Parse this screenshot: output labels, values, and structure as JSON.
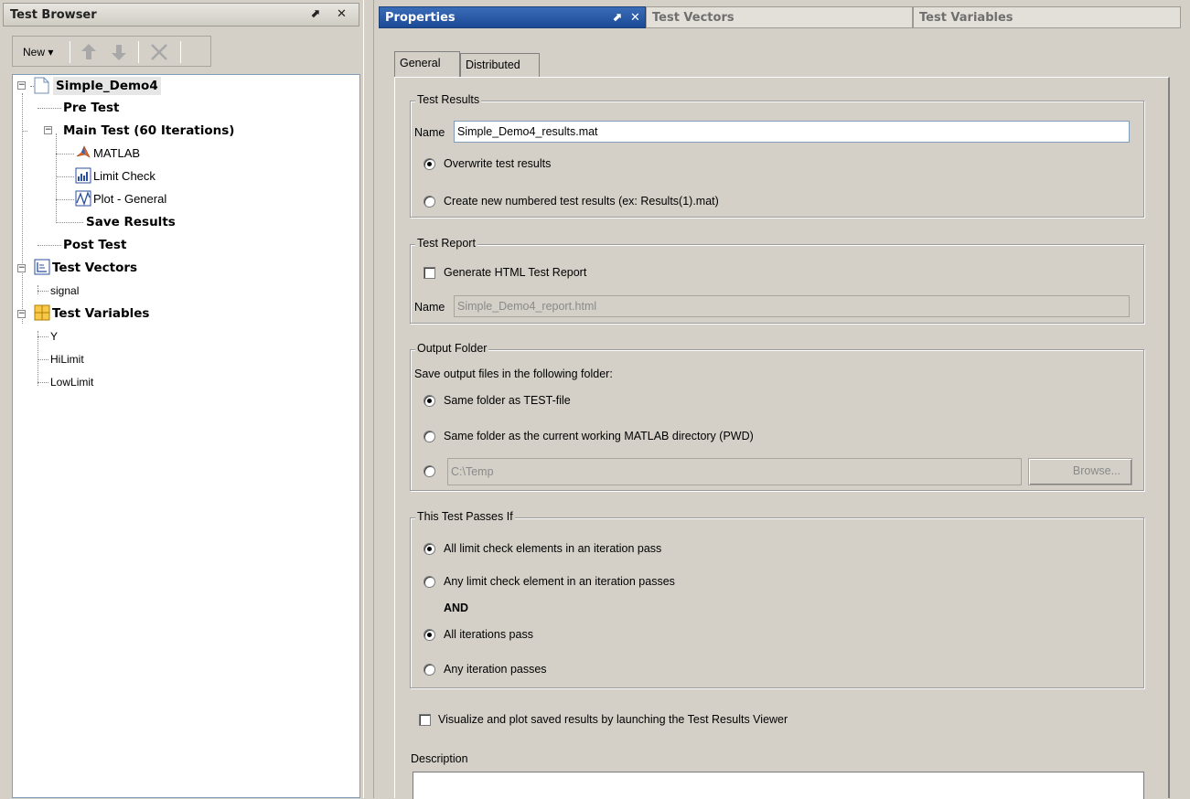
{
  "left_panel": {
    "title": "Test Browser",
    "undock": "⬈",
    "close": "✕",
    "toolbar": {
      "new_label": "New ▾"
    },
    "tree": {
      "root": "Simple_Demo4",
      "pre_test": "Pre Test",
      "main_test": "Main Test (60 Iterations)",
      "matlab": "MATLAB",
      "limit_check": "Limit Check",
      "plot_general": "Plot - General",
      "save_results": "Save Results",
      "post_test": "Post Test",
      "test_vectors": "Test Vectors",
      "signal": "signal",
      "test_variables": "Test Variables",
      "var_y": "Y",
      "var_hilimit": "HiLimit",
      "var_lowlimit": "LowLimit"
    }
  },
  "right_panel": {
    "tabs": [
      {
        "label": "Properties",
        "active": true
      },
      {
        "label": "Test Vectors",
        "active": false
      },
      {
        "label": "Test Variables",
        "active": false
      }
    ],
    "undock": "⬈",
    "close": "✕",
    "subtabs": {
      "general": "General",
      "distributed": "Distributed"
    },
    "test_results": {
      "legend": "Test Results",
      "name_label": "Name",
      "name_value": "Simple_Demo4_results.mat",
      "overwrite": "Overwrite test results",
      "create_new": "Create new numbered test results (ex: Results(1).mat)"
    },
    "test_report": {
      "legend": "Test Report",
      "generate": "Generate HTML Test Report",
      "name_label": "Name",
      "name_value": "Simple_Demo4_report.html"
    },
    "output_folder": {
      "legend": "Output Folder",
      "intro": "Save output files in the following folder:",
      "same_folder": "Same folder as TEST-file",
      "pwd_folder": "Same folder as the current working MATLAB directory (PWD)",
      "custom_path": "C:\\Temp",
      "browse": "Browse..."
    },
    "passes_if": {
      "legend": "This Test Passes If",
      "all_limit": "All limit check elements in an iteration pass",
      "any_limit": "Any limit check element in an iteration passes",
      "and_label": "AND",
      "all_iter": "All iterations pass",
      "any_iter": "Any iteration passes"
    },
    "visualize": "Visualize and plot saved results by launching the Test Results Viewer",
    "description_label": "Description"
  }
}
